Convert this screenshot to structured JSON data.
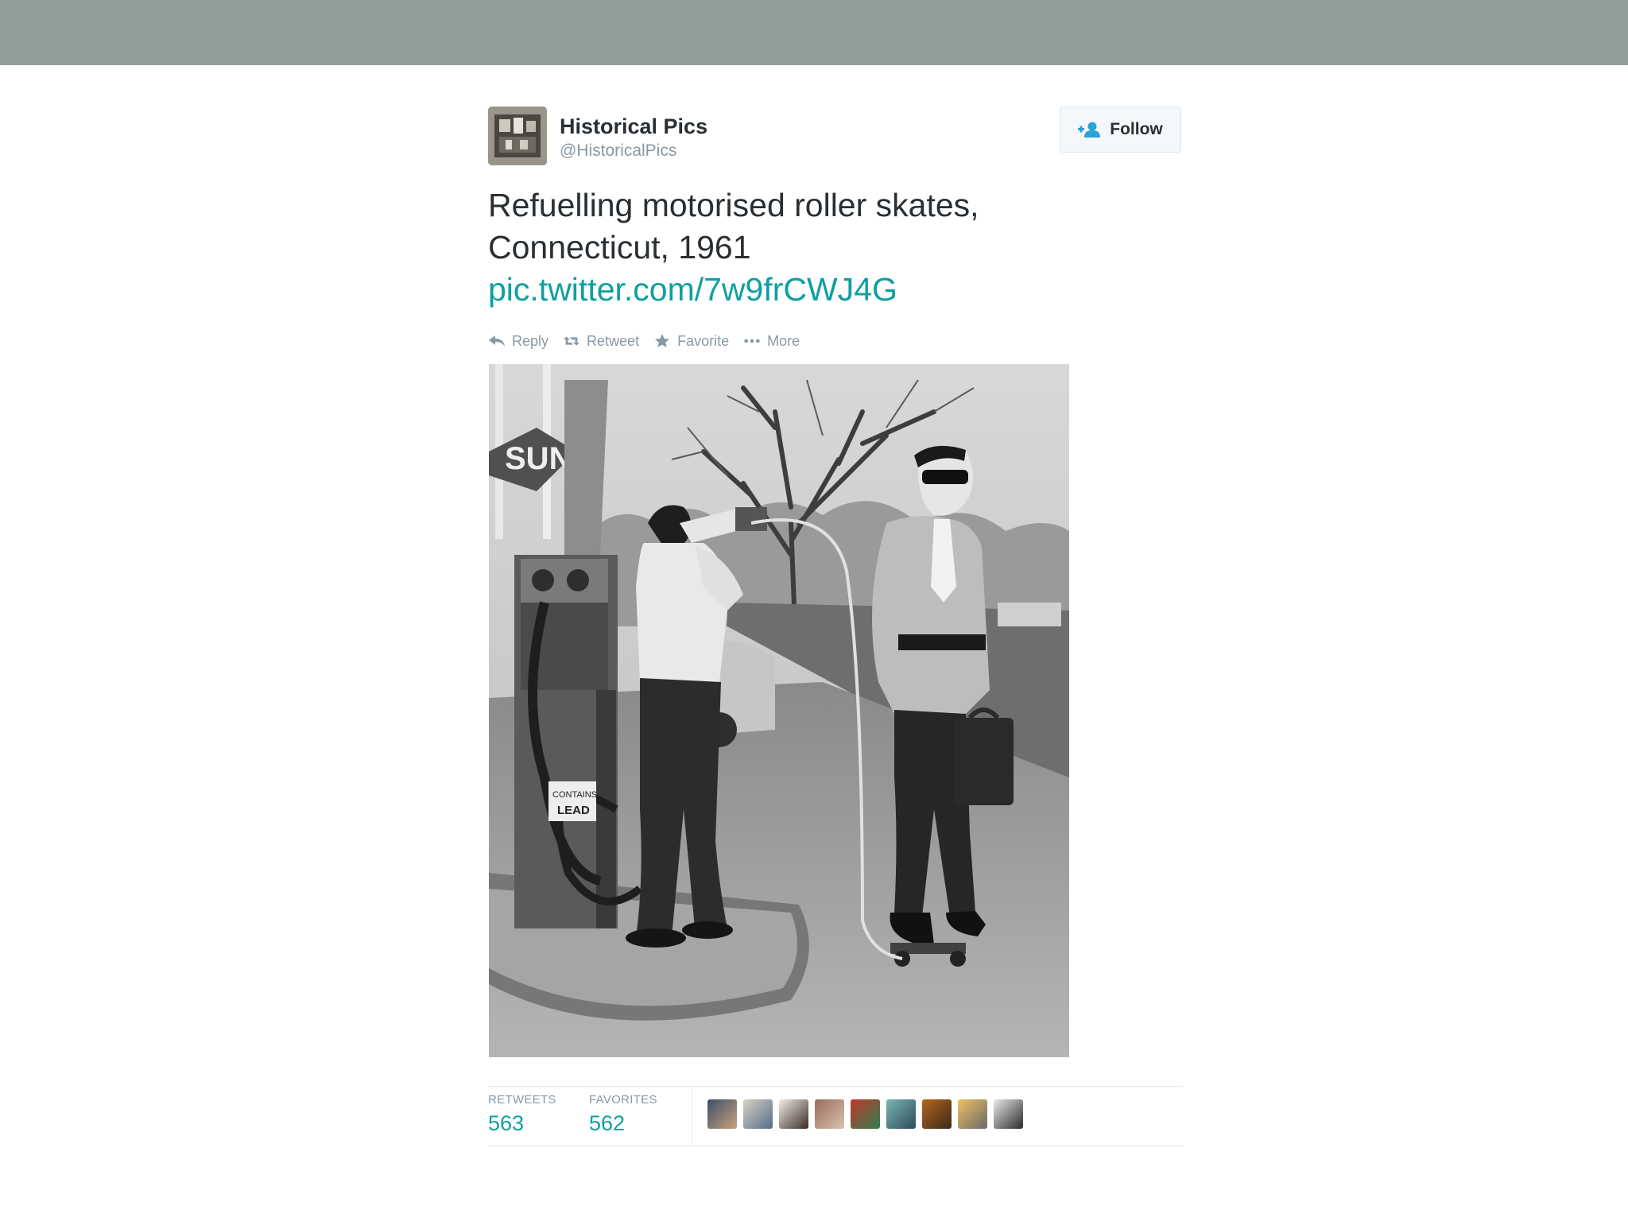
{
  "tweet": {
    "name": "Historical Pics",
    "handle": "@HistoricalPics",
    "follow_label": "Follow",
    "text_line1": "Refuelling motorised roller skates,",
    "text_line2": "Connecticut, 1961",
    "link": "pic.twitter.com/7w9frCWJ4G"
  },
  "actions": {
    "reply": "Reply",
    "retweet": "Retweet",
    "favorite": "Favorite",
    "more": "More"
  },
  "photo": {
    "sign_text": "SUN",
    "pump_label_1": "CONTAINS",
    "pump_label_2": "LEAD"
  },
  "stats": {
    "retweets_label": "RETWEETS",
    "retweets_value": "563",
    "favorites_label": "FAVORITES",
    "favorites_value": "562"
  },
  "colors": {
    "link": "#0f9fa0",
    "topbar": "#919f98",
    "muted": "#8899a6"
  }
}
